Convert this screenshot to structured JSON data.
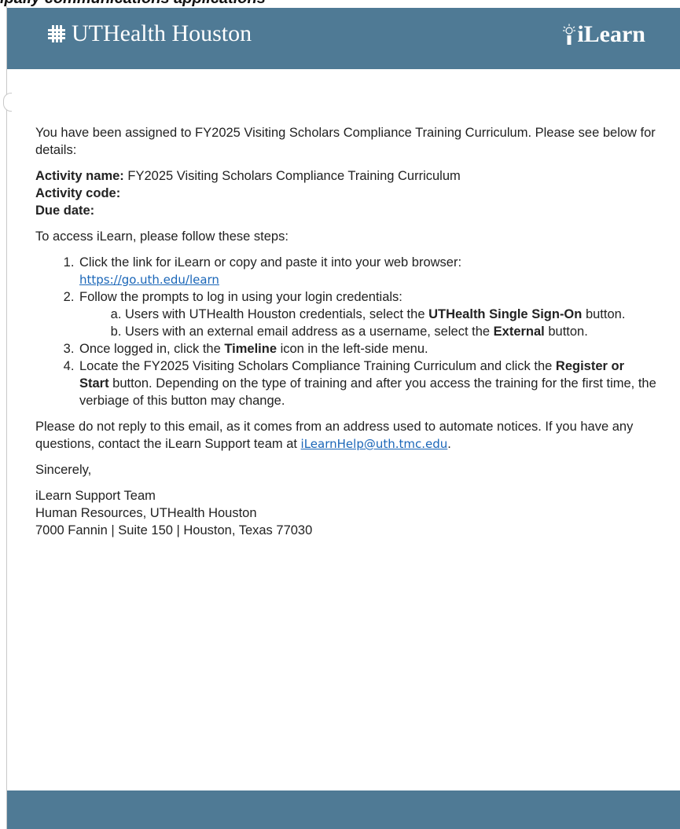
{
  "caption": "ipally communications applications",
  "header": {
    "brand": "UTHealth Houston",
    "app_name": "iLearn"
  },
  "intro": "You have been assigned to FY2025 Visiting Scholars Compliance Training Curriculum. Please see below for details:",
  "details": {
    "activity_name_label": "Activity name:",
    "activity_name_value": " FY2025 Visiting Scholars Compliance Training Curriculum",
    "activity_code_label": "Activity code:",
    "due_date_label": "Due date:"
  },
  "access_intro": "To access iLearn, please follow these steps:",
  "steps": {
    "s1_text": "Click the link for iLearn or copy and paste it into your web browser:",
    "s1_link": "https://go.uth.edu/learn",
    "s2_text": "Follow the prompts to log in using your login credentials:",
    "s2a_pre": "Users with UTHealth Houston credentials, select the ",
    "s2a_bold": "UTHealth Single Sign-On",
    "s2a_post": " button.",
    "s2b_pre": "Users with an external email address as a username, select the ",
    "s2b_bold": "External",
    "s2b_post": " button.",
    "s3_pre": "Once logged in, click the ",
    "s3_bold": "Timeline",
    "s3_post": " icon in the left-side menu.",
    "s4_pre": "Locate the FY2025 Visiting Scholars Compliance Training Curriculum and click the ",
    "s4_bold": "Register or Start",
    "s4_post": " button. Depending on the type of training and after you access the training for the first time, the verbiage of this button may change."
  },
  "notice": {
    "text": "Please do not reply to this email, as it comes from an address used to automate notices. If you have any questions, contact the iLearn Support team at ",
    "email": "iLearnHelp@uth.tmc.edu",
    "end": "."
  },
  "closing": "Sincerely,",
  "signature": {
    "line1": "iLearn Support Team",
    "line2": "Human Resources, UTHealth Houston",
    "line3": "7000 Fannin | Suite 150 | Houston, Texas 77030"
  },
  "colors": {
    "header_bg": "#4f7a95",
    "link": "#1a66b8"
  }
}
